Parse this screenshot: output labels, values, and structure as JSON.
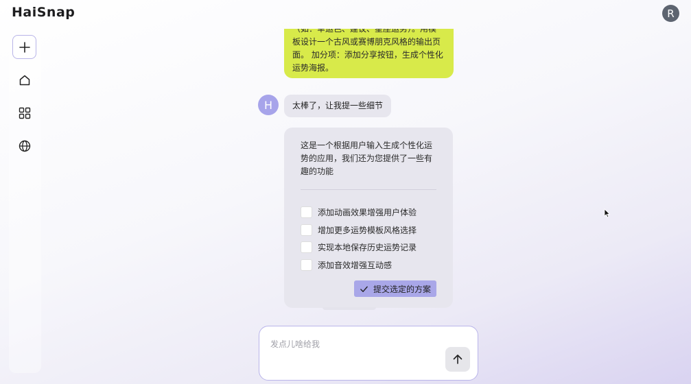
{
  "app": {
    "logo": "HaiSnap",
    "user_avatar_letter": "R"
  },
  "sidebar": {
    "items": [
      {
        "icon": "plus-icon"
      },
      {
        "icon": "home-icon"
      },
      {
        "icon": "apps-grid-icon"
      },
      {
        "icon": "globe-icon"
      }
    ]
  },
  "messages": {
    "user_prompt": "（如：幸运色、建议、星座运势）。用模板设计一个古风或赛博朋克风格的输出页面。 加分项：添加分享按钮，生成个性化运势海报。",
    "bot_avatar_letter": "H",
    "bot_reply": "太棒了，让我提一些细节",
    "card": {
      "intro": "这是一个根据用户输入生成个性化运势的应用，我们还为您提供了一些有趣的功能",
      "options": [
        {
          "label": "添加动画效果增强用户体验",
          "checked": false
        },
        {
          "label": "增加更多运势模板风格选择",
          "checked": false
        },
        {
          "label": "实现本地保存历史运势记录",
          "checked": false
        },
        {
          "label": "添加音效增强互动感",
          "checked": false
        }
      ],
      "submit_label": "提交选定的方案"
    }
  },
  "composer": {
    "placeholder": "发点儿啥给我",
    "value": ""
  },
  "colors": {
    "user_bubble": "#d8ea4a",
    "accent": "#a9a7e8",
    "bot_avatar": "#a7a4ea",
    "user_avatar": "#5d6470"
  }
}
